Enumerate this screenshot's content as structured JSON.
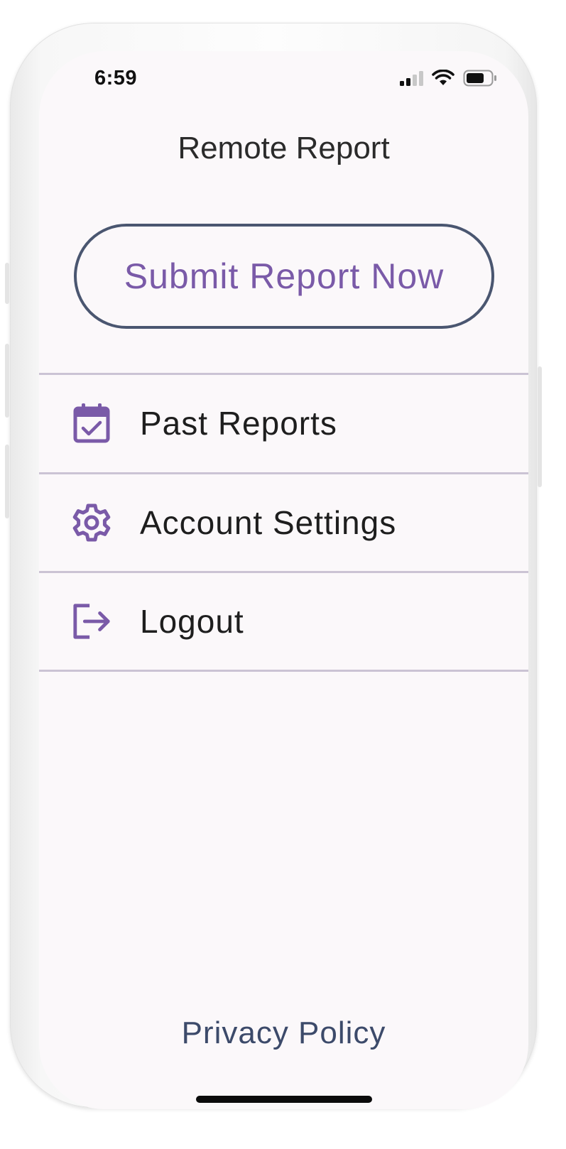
{
  "status_bar": {
    "time": "6:59",
    "icons": [
      "cellular-signal-icon",
      "wifi-icon",
      "battery-icon"
    ]
  },
  "header": {
    "title": "Remote Report"
  },
  "primary_action": {
    "label": "Submit Report Now"
  },
  "menu": {
    "items": [
      {
        "label": "Past Reports",
        "icon": "calendar-check-icon"
      },
      {
        "label": "Account Settings",
        "icon": "gear-icon"
      },
      {
        "label": "Logout",
        "icon": "logout-icon"
      }
    ]
  },
  "footer": {
    "privacy_label": "Privacy Policy"
  },
  "colors": {
    "accent": "#7a5aa8",
    "button_border": "#4a5670",
    "divider": "#cbc3d4",
    "background": "#fbf8fa",
    "footer_link": "#3c4a6a"
  }
}
